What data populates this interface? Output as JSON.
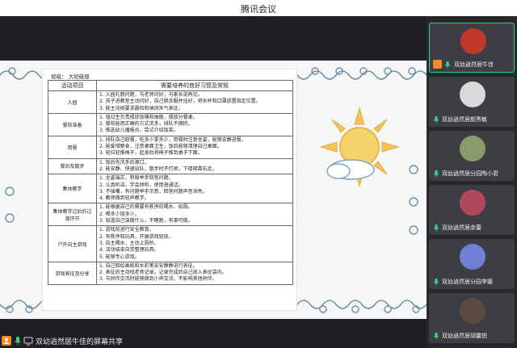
{
  "window": {
    "title": "腾讯会议"
  },
  "document": {
    "class_label": "班级：  大班级部",
    "headers": [
      "活动项目",
      "需要培养的良好习惯及常规"
    ],
    "rows": [
      {
        "activity": "入园",
        "requirements": "1. 入园礼貌问题，与老师问好，与家长说再见。\n2. 孩子进教室主动问好，自己脱衣服并挂好，将水杯和口罩放置指定位置。\n3. 能主动按要求晨检和抽测天气表征。"
      },
      {
        "activity": "餐前准备",
        "requirements": "1. 值日生负责摆放饭桶和抽筋，摆放分餐桌。\n2. 餐前能用正确的方式洗手，排队不拥挤。\n3. 推选幼儿播报员，尝试介绍饭菜。"
      },
      {
        "activity": "用餐",
        "requirements": "1. 排队自己取餐，吃多少拿多少，用餐时注意坐姿，能够安静进餐。\n2. 能爱惜粮食，注意桌面卫生，饭后能够清理自己桌面。\n3. 轻拉轻推椅子，起身后将椅子推到桌子下面。"
      },
      {
        "activity": "餐后及散步",
        "requirements": "1. 饭后先洗手后漱口。\n2. 能安静、快速站队，散步时不打闹，下楼梯靠右走。"
      },
      {
        "activity": "集体教学",
        "requirements": "1. 坐姿端正，积极举手回答问题。\n2. 认真听讲，学会倾听，使用普通话。\n3. 不插嘴，有问题举手示意，回答问题声音洪亮。\n4. 教师做到轻声教学。"
      },
      {
        "activity": "集体教学过后的过渡环节",
        "requirements": "1. 能根据自己的需要有秩序的喝水、如厕。\n2. 喝多少接多少。\n3. 知道自己该做什么，不瞎跑，有事可做。"
      },
      {
        "activity": "户外自主游戏",
        "requirements": "1. 游戏前进行安全教育。\n2. 有秩序取玩具，开展游戏轻放。\n3. 自主喝水，主动上厕所。\n4. 活动结束自觉整理玩具。\n5. 能够专心游戏。"
      },
      {
        "activity": "游戏表征及分享",
        "requirements": "1. 自己取绘画纸和水彩笔安安静静进行表征。\n2. 表征后主动找老师记录。记录完成后自己放入表征袋内。\n3. 与同伴交流时能够做到小声交流，不影响其他同伴。"
      }
    ]
  },
  "share_bar": {
    "label": "双幼逍然居牛佳的屏幕共享"
  },
  "participants": [
    {
      "name": "双幼逍然居牛佳",
      "active": true,
      "host": true,
      "avatar_color": "#c0392b"
    },
    {
      "name": "双幼逍然居颜秀敏",
      "active": false,
      "host": false,
      "avatar_color": "#d9d9d9"
    },
    {
      "name": "双幼逍然居分园陶小君",
      "active": false,
      "host": false,
      "avatar_color": "#8a9a6a"
    },
    {
      "name": "双幼逍然居余蕾",
      "active": false,
      "host": false,
      "avatar_color": "#b0485c"
    },
    {
      "name": "双幼逍然居分园李媛",
      "active": false,
      "host": false,
      "avatar_color": "#6f7fd6"
    },
    {
      "name": "双幼逍然居胡馨悦",
      "active": false,
      "host": false,
      "avatar_color": "#5a4a40"
    }
  ],
  "icons": {
    "host": "host-icon",
    "mic": "mic-icon",
    "share": "screen-share-icon"
  },
  "colors": {
    "accent_green": "#3ad37c",
    "wave_blue": "#6f8fa6",
    "host_orange": "#f08a2b"
  }
}
